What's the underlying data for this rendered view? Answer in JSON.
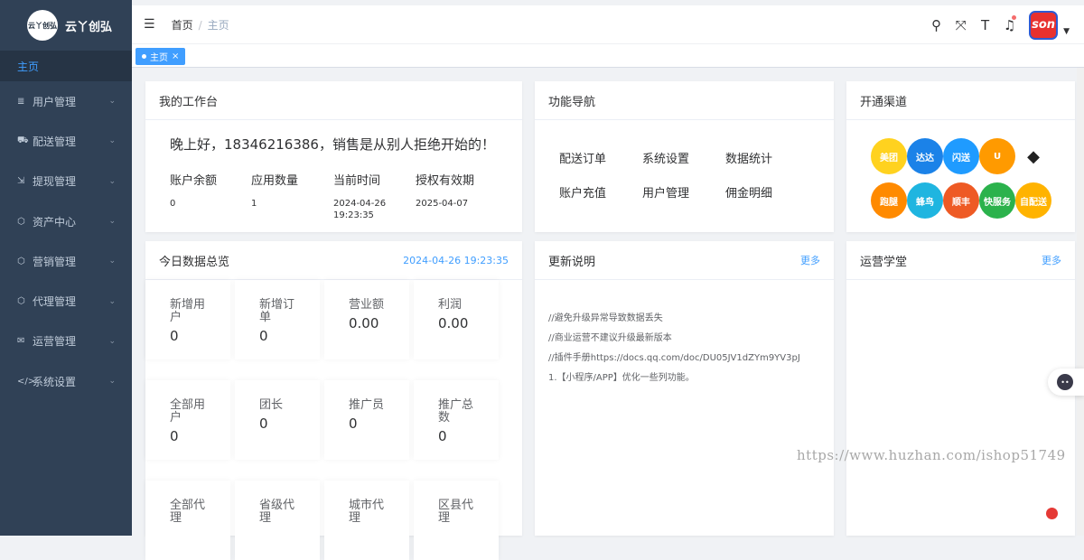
{
  "app": {
    "logo_text": "云丫创弘",
    "logo_badge": "云丫创弘"
  },
  "sidebar": {
    "home": "主页",
    "items": [
      {
        "label": "用户管理",
        "icon": "list-icon"
      },
      {
        "label": "配送管理",
        "icon": "truck-icon"
      },
      {
        "label": "提现管理",
        "icon": "withdraw-icon"
      },
      {
        "label": "资产中心",
        "icon": "cube-icon"
      },
      {
        "label": "营销管理",
        "icon": "cube-icon"
      },
      {
        "label": "代理管理",
        "icon": "cube-icon"
      },
      {
        "label": "运营管理",
        "icon": "mail-icon"
      },
      {
        "label": "系统设置",
        "icon": "code-icon"
      }
    ]
  },
  "header": {
    "breadcrumb_home": "首页",
    "breadcrumb_sep": "/",
    "breadcrumb_current": "主页",
    "avatar_text": "son"
  },
  "tags": {
    "active": "主页",
    "close": "×"
  },
  "workspace": {
    "title": "我的工作台",
    "greeting": "晚上好，18346216386，销售是从别人拒绝开始的！",
    "labels": [
      "账户余额",
      "应用数量",
      "当前时间",
      "授权有效期"
    ],
    "values": [
      "0",
      "1",
      "2024-04-26 19:23:35",
      "2025-04-07"
    ]
  },
  "function_nav": {
    "title": "功能导航",
    "links": [
      "配送订单",
      "系统设置",
      "数据统计",
      "账户充值",
      "用户管理",
      "佣金明细"
    ]
  },
  "channels": {
    "title": "开通渠道",
    "apps": [
      {
        "label": "美团",
        "color": "#ffd21f"
      },
      {
        "label": "达达",
        "color": "#1b82e8"
      },
      {
        "label": "闪送",
        "color": "#1f9bff"
      },
      {
        "label": "U",
        "color": "#ff9a00"
      },
      {
        "label": "◆",
        "color": "#ffffff"
      },
      {
        "label": "跑腿",
        "color": "#ff8a00"
      },
      {
        "label": "蜂鸟",
        "color": "#1fb5e0"
      },
      {
        "label": "顺丰",
        "color": "#ee5a24"
      },
      {
        "label": "快服务",
        "color": "#2bb24c"
      },
      {
        "label": "自配送",
        "color": "#ffb300"
      }
    ]
  },
  "today": {
    "title": "今日数据总览",
    "timestamp": "2024-04-26 19:23:35",
    "stats": [
      {
        "label": "新增用户",
        "value": "0"
      },
      {
        "label": "新增订单",
        "value": "0"
      },
      {
        "label": "营业额",
        "value": "0.00"
      },
      {
        "label": "利润",
        "value": "0.00"
      },
      {
        "label": "全部用户",
        "value": "0"
      },
      {
        "label": "团长",
        "value": "0"
      },
      {
        "label": "推广员",
        "value": "0"
      },
      {
        "label": "推广总数",
        "value": "0"
      },
      {
        "label": "全部代理",
        "value": ""
      },
      {
        "label": "省级代理",
        "value": ""
      },
      {
        "label": "城市代理",
        "value": ""
      },
      {
        "label": "区县代理",
        "value": ""
      }
    ]
  },
  "updates": {
    "title": "更新说明",
    "more": "更多",
    "lines": [
      "//避免升级异常导致数据丢失",
      "//商业运营不建议升级最新版本",
      "//插件手册https://docs.qq.com/doc/DU05JV1dZYm9YV3pJ",
      "1.【小程序/APP】优化一些列功能。"
    ]
  },
  "academy": {
    "title": "运营学堂",
    "more": "更多"
  },
  "watermark": "https://www.huzhan.com/ishop51749"
}
